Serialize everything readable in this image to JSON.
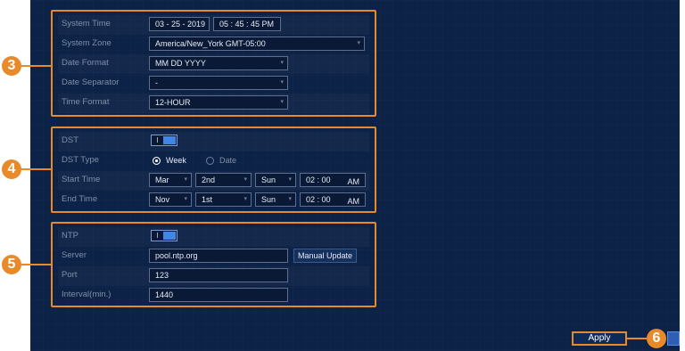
{
  "system": {
    "time_label": "System Time",
    "date_value": "03 - 25 - 2019",
    "time_value": "05 : 45 : 45 PM",
    "zone_label": "System Zone",
    "zone_value": "America/New_York GMT-05:00",
    "date_format_label": "Date Format",
    "date_format_value": "MM DD YYYY",
    "date_separator_label": "Date Separator",
    "date_separator_value": "-",
    "time_format_label": "Time Format",
    "time_format_value": "12-HOUR"
  },
  "dst": {
    "label": "DST",
    "toggle_text": "I",
    "type_label": "DST Type",
    "type_week": "Week",
    "type_date": "Date",
    "start_label": "Start Time",
    "start_month": "Mar",
    "start_week": "2nd",
    "start_day": "Sun",
    "start_time": "02 : 00",
    "start_ampm": "AM",
    "end_label": "End Time",
    "end_month": "Nov",
    "end_week": "1st",
    "end_day": "Sun",
    "end_time": "02 : 00",
    "end_ampm": "AM"
  },
  "ntp": {
    "label": "NTP",
    "toggle_text": "I",
    "server_label": "Server",
    "server_value": "pool.ntp.org",
    "manual_update": "Manual Update",
    "port_label": "Port",
    "port_value": "123",
    "interval_label": "Interval(min.)",
    "interval_value": "1440"
  },
  "apply_label": "Apply",
  "callouts": {
    "c3": "3",
    "c4": "4",
    "c5": "5",
    "c6": "6"
  },
  "colors": {
    "accent": "#e8892a",
    "background": "#0d2247",
    "toggle_on": "#3f86e6"
  },
  "icons": {
    "dropdown": "chevron-down-icon"
  }
}
